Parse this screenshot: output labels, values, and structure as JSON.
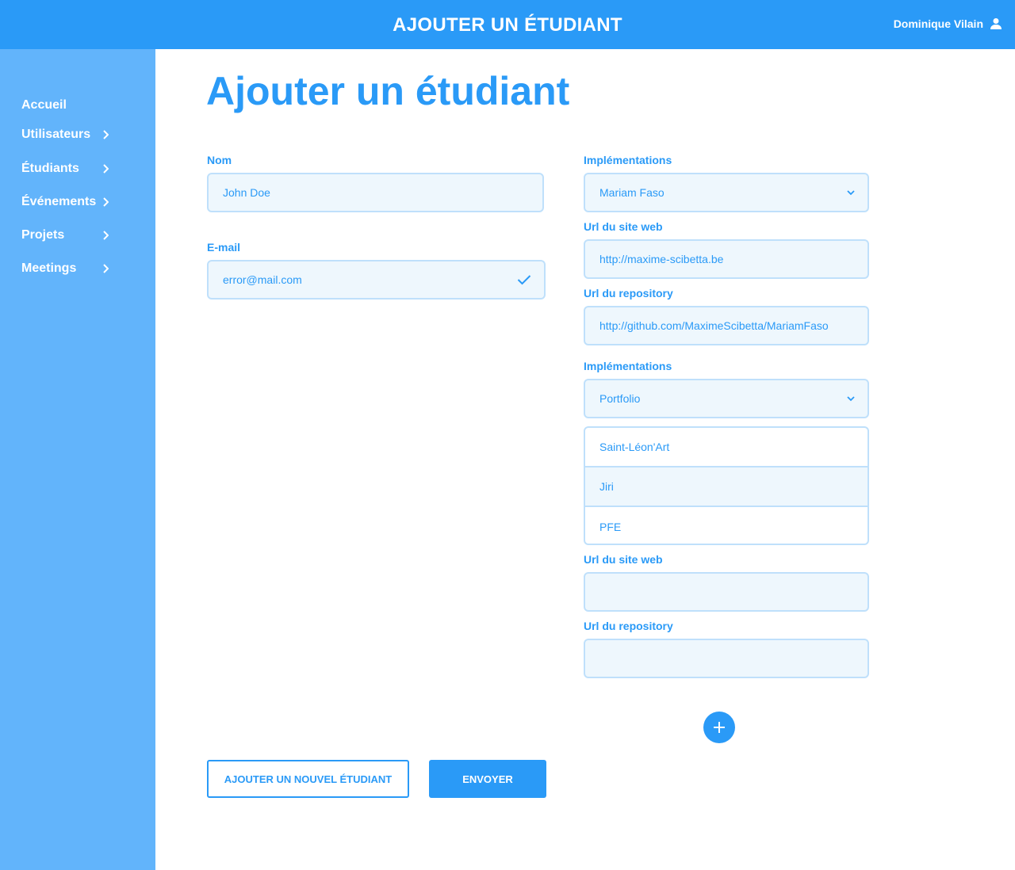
{
  "header": {
    "title": "AJOUTER UN ÉTUDIANT",
    "user_name": "Dominique Vilain"
  },
  "sidebar": {
    "items": [
      {
        "label": "Accueil",
        "has_chevron": false
      },
      {
        "label": "Utilisateurs",
        "has_chevron": true
      },
      {
        "label": "Étudiants",
        "has_chevron": true
      },
      {
        "label": "Événements",
        "has_chevron": true
      },
      {
        "label": "Projets",
        "has_chevron": true
      },
      {
        "label": "Meetings",
        "has_chevron": true
      }
    ]
  },
  "main": {
    "page_title": "Ajouter un étudiant",
    "form": {
      "nom": {
        "label": "Nom",
        "value": "John Doe"
      },
      "email": {
        "label": "E-mail",
        "value": "error@mail.com",
        "status_icon": "check-icon"
      },
      "implementation1": {
        "label": "Implémentations",
        "selected": "Mariam Faso",
        "site_label": "Url du site web",
        "site_value": "http://maxime-scibetta.be",
        "repo_label": "Url du repository",
        "repo_value": "http://github.com/MaximeScibetta/MariamFaso"
      },
      "implementation2": {
        "label": "Implémentations",
        "selected": "Portfolio",
        "options": [
          "Saint-Léon'Art",
          "Jiri",
          "PFE"
        ],
        "hovered_option": "Jiri",
        "site_label": "Url du site web",
        "site_value": "",
        "repo_label": "Url du repository",
        "repo_value": ""
      }
    },
    "buttons": {
      "add_new": "AJOUTER UN NOUVEL ÉTUDIANT",
      "submit": "ENVOYER"
    }
  },
  "colors": {
    "primary": "#2a9af7",
    "sidebar": "#62b4fb",
    "field_bg": "#eef7fd",
    "field_border": "#bfe0fb"
  }
}
